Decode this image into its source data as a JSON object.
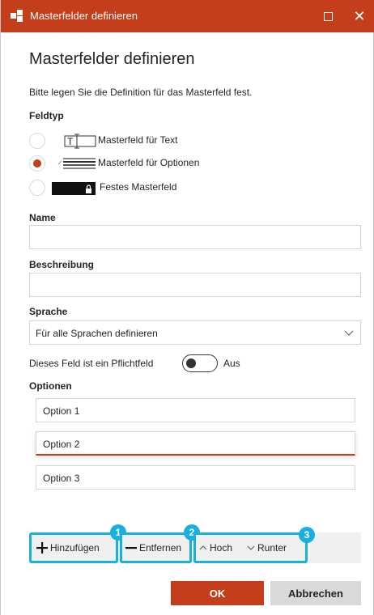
{
  "window": {
    "title": "Masterfelder definieren",
    "maximize_icon": "maximize-icon",
    "close_glyph": "✕"
  },
  "dialog": {
    "heading": "Masterfelder definieren",
    "description": "Bitte legen Sie die Definition für das Masterfeld fest."
  },
  "field_type": {
    "label": "Feldtyp",
    "options": [
      {
        "label": "Masterfeld für Text",
        "icon": "text-field-icon",
        "selected": false
      },
      {
        "label": "Masterfeld für Optionen",
        "icon": "options-list-icon",
        "selected": true
      },
      {
        "label": "Festes Masterfeld",
        "icon": "locked-field-icon",
        "selected": false
      }
    ]
  },
  "name": {
    "label": "Name",
    "value": ""
  },
  "beschreibung": {
    "label": "Beschreibung",
    "value": ""
  },
  "sprache": {
    "label": "Sprache",
    "value": "Für alle Sprachen definieren"
  },
  "required": {
    "label": "Dieses Feld ist ein Pflichtfeld",
    "state": "Aus",
    "on": false
  },
  "optionen": {
    "label": "Optionen",
    "items": [
      "Option 1",
      "Option 2",
      "Option 3"
    ],
    "active_index": 1
  },
  "toolbar": {
    "add": {
      "label": "Hinzufügen",
      "badge": "1"
    },
    "remove": {
      "label": "Entfernen",
      "badge": "2"
    },
    "up": {
      "label": "Hoch"
    },
    "down": {
      "label": "Runter"
    },
    "move_badge": "3"
  },
  "buttons": {
    "ok": "OK",
    "cancel": "Abbrechen"
  },
  "colors": {
    "accent": "#c43e1c",
    "highlight": "#1ab0de"
  }
}
